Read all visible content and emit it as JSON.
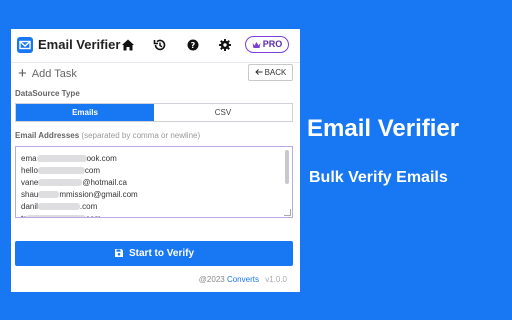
{
  "app": {
    "title": "Email Verifier",
    "pro_label": "PRO"
  },
  "toolbar": {
    "add_task_label": "Add Task",
    "back_label": "BACK"
  },
  "datasource": {
    "label": "DataSource Type",
    "options": [
      "Emails",
      "CSV"
    ],
    "selected": "Emails"
  },
  "emails": {
    "label": "Email Addresses",
    "hint": "(separated by comma or newline)",
    "lines": [
      {
        "prefix": "ema",
        "suffix": "ook.com"
      },
      {
        "prefix": "hello",
        "suffix": "com"
      },
      {
        "prefix": "vane",
        "suffix": "@hotmail.ca"
      },
      {
        "prefix": "shau",
        "suffix": "mmission@gmail.com"
      },
      {
        "prefix": "danil",
        "suffix": ".com"
      },
      {
        "prefix": "tr",
        "suffix": "com"
      }
    ]
  },
  "actions": {
    "verify_label": "Start to Verify"
  },
  "footer": {
    "copyright": "@2023",
    "brand": "Converts",
    "version": "v1.0.0"
  },
  "promo": {
    "title": "Email Verifier",
    "subtitle": "Bulk Verify Emails"
  },
  "colors": {
    "background": "#1877f2",
    "accent": "#1877f2",
    "pro": "#7b3fd8"
  },
  "icons": [
    "mail-logo-icon",
    "home-icon",
    "history-icon",
    "help-icon",
    "gear-icon",
    "crown-icon",
    "plus-icon",
    "arrow-left-icon",
    "save-icon"
  ]
}
